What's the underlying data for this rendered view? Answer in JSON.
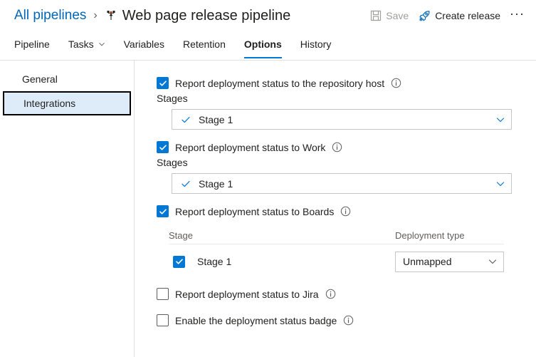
{
  "header": {
    "breadcrumb_link": "All pipelines",
    "breadcrumb_separator": "›",
    "title": "Web page release pipeline",
    "pipeline_icon": "release-pipeline-icon",
    "toolbar": {
      "save_label": "Save",
      "save_icon": "save-floppy-icon",
      "save_enabled": false,
      "create_release_label": "Create release",
      "create_release_icon": "rocket-icon",
      "more_label": "···"
    }
  },
  "tabs": [
    {
      "label": "Pipeline",
      "selected": false,
      "has_caret": false
    },
    {
      "label": "Tasks",
      "selected": false,
      "has_caret": true
    },
    {
      "label": "Variables",
      "selected": false,
      "has_caret": false
    },
    {
      "label": "Retention",
      "selected": false,
      "has_caret": false
    },
    {
      "label": "Options",
      "selected": true,
      "has_caret": false
    },
    {
      "label": "History",
      "selected": false,
      "has_caret": false
    }
  ],
  "sidebar": {
    "items": [
      {
        "label": "General",
        "selected": false
      },
      {
        "label": "Integrations",
        "selected": true
      }
    ]
  },
  "options": {
    "repository_host": {
      "label": "Report deployment status to the repository host",
      "checked": true,
      "info_icon": "info-icon",
      "stages_label": "Stages",
      "stages_value": "Stage 1"
    },
    "work": {
      "label": "Report deployment status to Work",
      "checked": true,
      "info_icon": "info-icon",
      "stages_label": "Stages",
      "stages_value": "Stage 1"
    },
    "boards": {
      "label": "Report deployment status to Boards",
      "checked": true,
      "info_icon": "info-icon",
      "table": {
        "columns": [
          "Stage",
          "Deployment type"
        ],
        "rows": [
          {
            "stage": "Stage 1",
            "checked": true,
            "deployment_type": "Unmapped"
          }
        ]
      }
    },
    "jira": {
      "label": "Report deployment status to Jira",
      "checked": false,
      "info_icon": "info-icon"
    },
    "status_badge": {
      "label": "Enable the deployment status badge",
      "checked": false,
      "info_icon": "info-icon"
    }
  },
  "colors": {
    "accent": "#0078d4",
    "link": "#0067b8",
    "selected_bg": "#deecf9",
    "border": "#c8c6c4",
    "muted_text": "#605e5c"
  }
}
